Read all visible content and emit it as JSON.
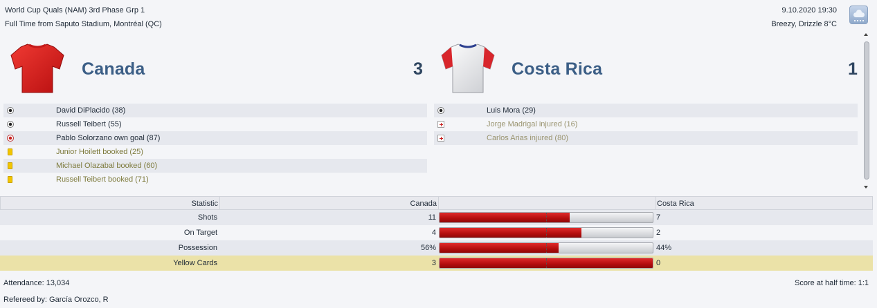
{
  "header": {
    "competition": "World Cup Quals (NAM) 3rd Phase Grp 1",
    "result_line": "Full Time from Saputo Stadium, Montréal (QC)",
    "datetime": "9.10.2020 19:30",
    "weather": "Breezy, Drizzle 8°C",
    "weather_icon": "drizzle-cloud-icon"
  },
  "home": {
    "name": "Canada",
    "score": "3",
    "shirt_color": "#e0201f",
    "events": [
      {
        "icon": "goal-ball-icon",
        "type": "goal",
        "text": "David DiPlacido (38)"
      },
      {
        "icon": "goal-ball-icon",
        "type": "goal",
        "text": "Russell Teibert (55)"
      },
      {
        "icon": "own-goal-ball-icon",
        "type": "own-goal",
        "text": "Pablo Solorzano own goal (87)"
      },
      {
        "icon": "yellow-card-icon",
        "type": "booking",
        "text": "Junior Hoilett booked (25)"
      },
      {
        "icon": "yellow-card-icon",
        "type": "booking",
        "text": "Michael Olazabal booked (60)"
      },
      {
        "icon": "yellow-card-icon",
        "type": "booking",
        "text": "Russell Teibert booked (71)"
      }
    ]
  },
  "away": {
    "name": "Costa Rica",
    "score": "1",
    "shirt_color": "#f2f2f2",
    "events": [
      {
        "icon": "goal-ball-icon",
        "type": "goal",
        "text": "Luis Mora (29)"
      },
      {
        "icon": "injury-icon",
        "type": "injury",
        "text": "Jorge Madrigal injured (16)"
      },
      {
        "icon": "injury-icon",
        "type": "injury",
        "text": "Carlos Arias injured (80)"
      }
    ]
  },
  "stats": {
    "col_statistic": "Statistic",
    "col_home": "Canada",
    "col_away": "Costa Rica",
    "rows": [
      {
        "label": "Shots",
        "home": "11",
        "away": "7",
        "home_share": 0.611
      },
      {
        "label": "On Target",
        "home": "4",
        "away": "2",
        "home_share": 0.667
      },
      {
        "label": "Possession",
        "home": "56%",
        "away": "44%",
        "home_share": 0.56
      },
      {
        "label": "Yellow Cards",
        "home": "3",
        "away": "0",
        "home_share": 1.0
      }
    ]
  },
  "footer": {
    "attendance": "Attendance: 13,034",
    "half_time": "Score at half time: 1:1",
    "referee": "Refereed by: García Orozco, R"
  },
  "colors": {
    "bar_fill": "#c81515",
    "highlight_row": "#ebe2a8",
    "team_name": "#3b5e86"
  }
}
